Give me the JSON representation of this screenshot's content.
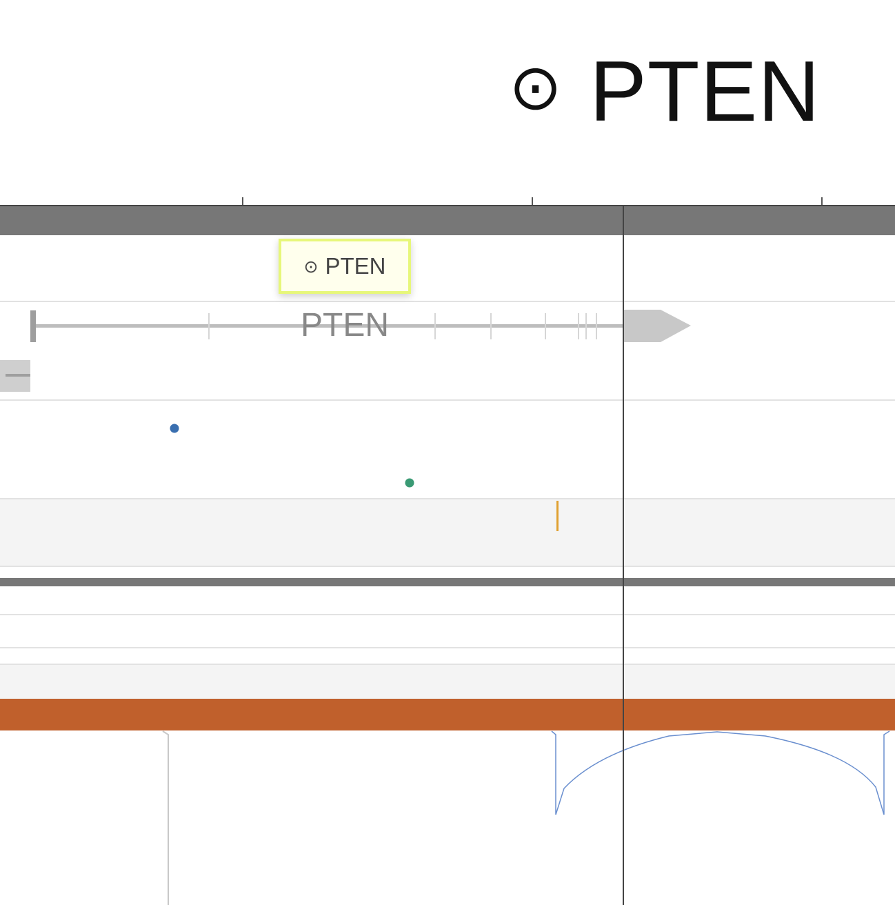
{
  "header": {
    "icon": "target-icon",
    "icon_glyph": "⊙",
    "gene_name": "PTEN"
  },
  "tooltip": {
    "icon": "target-icon",
    "icon_glyph": "⊙",
    "text": "PTEN"
  },
  "gene_track": {
    "label": "PTEN",
    "strand": "forward"
  },
  "colors": {
    "track_band": "#777777",
    "tooltip_background": "#ffffed",
    "tooltip_border": "#e7f77a",
    "variant_blue": "#3a6fb0",
    "variant_green": "#3a9a74",
    "variant_orange": "#e0a030",
    "coverage_bar": "#c0602c",
    "splice_arc": "#6a8fcf",
    "cursor_line": "#444444"
  }
}
